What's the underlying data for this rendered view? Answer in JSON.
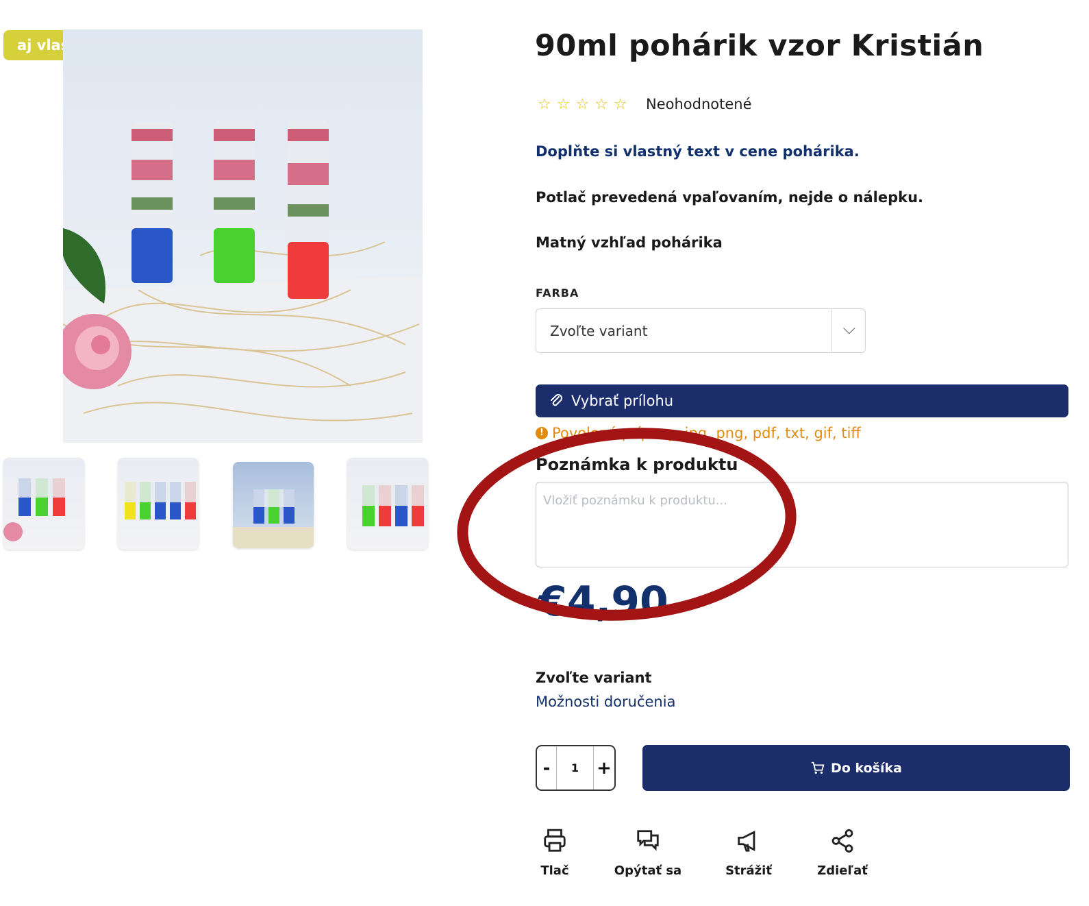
{
  "badge": {
    "label": "aj vlastný text"
  },
  "product": {
    "title": "90ml pohárik vzor Kristián",
    "rating_text": "Neohodnotené",
    "stars": 5,
    "desc_blue": "Doplňte si vlastný text v cene pohárika.",
    "desc_line2": "Potlač prevedená vpaľovaním, nejde o nálepku.",
    "desc_line3": "Matný vzhľad pohárika"
  },
  "variant_select": {
    "label": "FARBA",
    "value": "Zvoľte variant"
  },
  "attachment": {
    "button_label": "Vybrať prílohu",
    "note": "Povolené prípony: jpg, png, pdf, txt, gif, tiff"
  },
  "note_field": {
    "label": "Poznámka k produktu",
    "placeholder": "Vložiť poznámku k produktu..."
  },
  "price": "€4,90",
  "availability": {
    "title": "Zvoľte variant",
    "delivery_link": "Možnosti doručenia"
  },
  "quantity": {
    "minus": "-",
    "value": "1",
    "plus": "+"
  },
  "cart_button": "Do košíka",
  "actions": [
    {
      "icon": "printer-icon",
      "label": "Tlač"
    },
    {
      "icon": "chat-icon",
      "label": "Opýtať sa"
    },
    {
      "icon": "megaphone-icon",
      "label": "Strážiť"
    },
    {
      "icon": "share-icon",
      "label": "Zdieľať"
    }
  ],
  "colors": {
    "primary": "#1b2d6b",
    "badge": "#d6d13a",
    "warning": "#e08b10",
    "annotation": "#a31414"
  }
}
